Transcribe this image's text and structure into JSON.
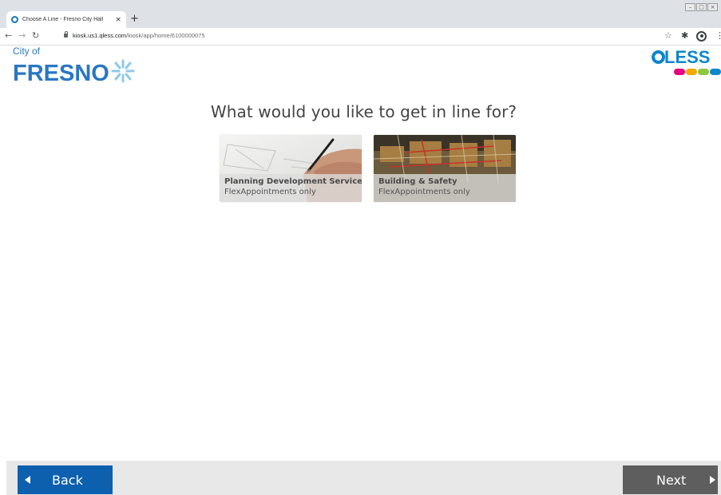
{
  "browser": {
    "tab_title": "Choose A Line - Fresno City Hall",
    "tab_close": "×",
    "new_tab": "+",
    "url_host": "kiosk.us1.qless.com",
    "url_path": "/kiosk/app/home/6100000075",
    "icons": [
      "back-arrow-icon",
      "forward-arrow-icon",
      "reload-icon",
      "lock-icon",
      "star-icon",
      "extensions-icon",
      "profile-icon",
      "menu-icon"
    ]
  },
  "branding": {
    "city_of": "City of",
    "city_name": "FRESNO",
    "qless_name": "LESS",
    "qless_dot_colors": [
      "#e6007e",
      "#f7a600",
      "#8dc63f",
      "#0e86cc"
    ],
    "city_color": "#2a77c4",
    "qless_color": "#0e86cc"
  },
  "main": {
    "heading": "What would you like to get in line for?",
    "services": [
      {
        "title": "Planning Development Services",
        "subtitle": "FlexAppointments only"
      },
      {
        "title": "Building & Safety",
        "subtitle": "FlexAppointments only"
      }
    ]
  },
  "footer": {
    "back_label": "Back",
    "next_label": "Next",
    "back_color": "#0d60ad",
    "next_color": "#5e5e5e"
  }
}
